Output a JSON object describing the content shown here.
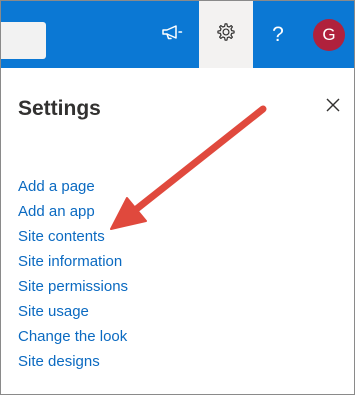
{
  "header": {
    "avatar_initial": "G",
    "help_glyph": "?",
    "icons": [
      "megaphone-icon",
      "gear-icon",
      "help-icon"
    ],
    "accent_color": "#0b78d4",
    "avatar_color": "#b0213c"
  },
  "settings_panel": {
    "title": "Settings",
    "close_icon": "close-icon",
    "links": [
      {
        "label": "Add a page"
      },
      {
        "label": "Add an app"
      },
      {
        "label": "Site contents"
      },
      {
        "label": "Site information"
      },
      {
        "label": "Site permissions"
      },
      {
        "label": "Site usage"
      },
      {
        "label": "Change the look"
      },
      {
        "label": "Site designs"
      }
    ],
    "link_color": "#0b6ac1"
  },
  "annotation": {
    "type": "arrow",
    "color": "#e0493d",
    "points_to": "Site contents"
  }
}
